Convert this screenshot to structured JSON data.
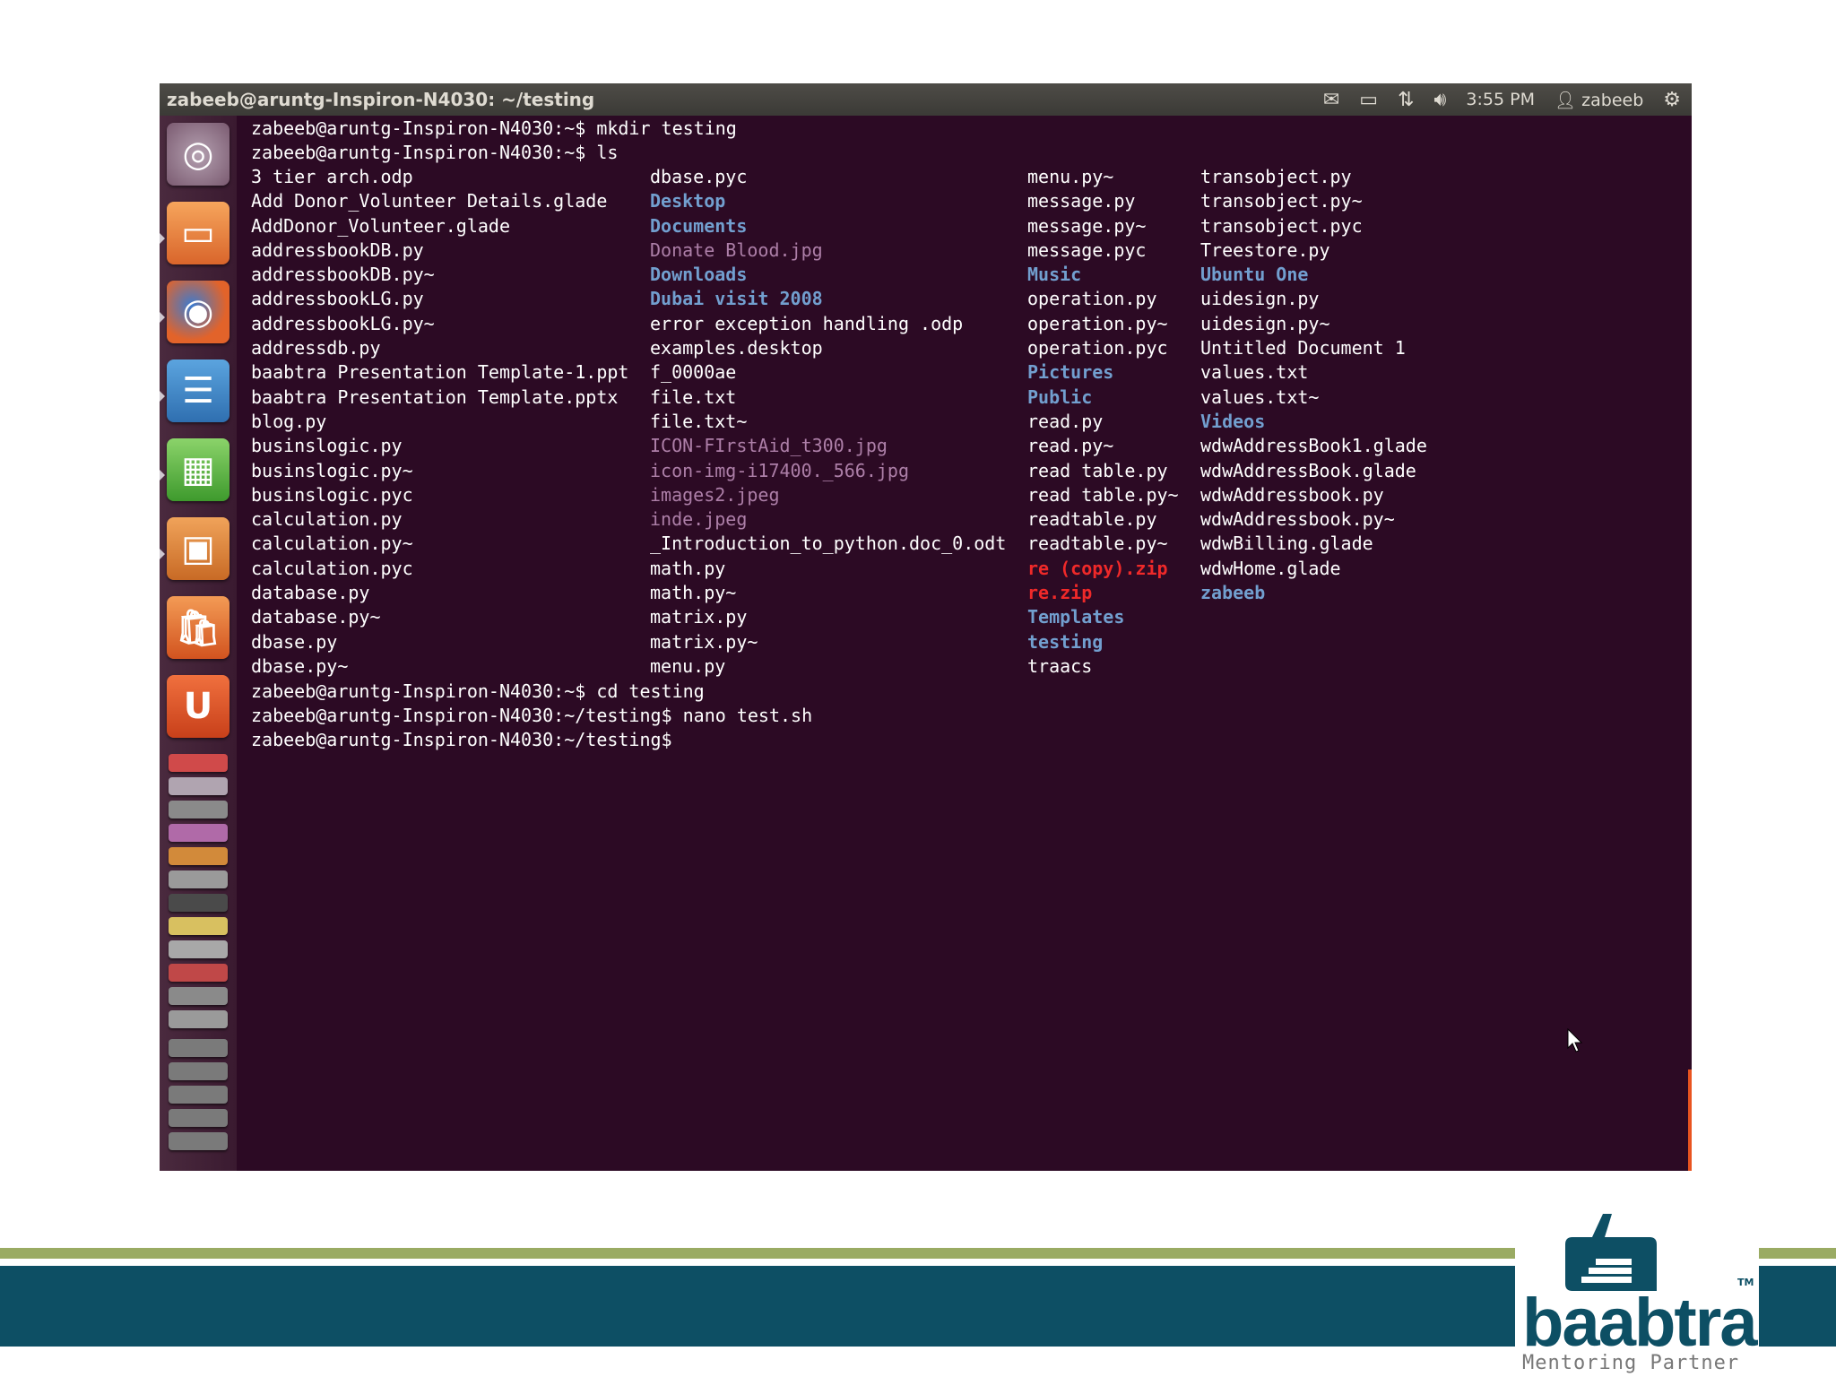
{
  "topbar": {
    "title": "zabeeb@aruntg-Inspiron-N4030: ~/testing",
    "clock": "3:55 PM",
    "user": "zabeeb",
    "icons": [
      "mail-icon",
      "battery-icon",
      "network-icon",
      "volume-icon",
      "user-icon",
      "power-icon"
    ]
  },
  "terminal": {
    "lines_top": [
      "zabeeb@aruntg-Inspiron-N4030:~$ mkdir testing",
      "zabeeb@aruntg-Inspiron-N4030:~$ ls"
    ],
    "col1": [
      {
        "t": "3 tier arch.odp",
        "k": "file"
      },
      {
        "t": "Add Donor_Volunteer Details.glade",
        "k": "file"
      },
      {
        "t": "AddDonor_Volunteer.glade",
        "k": "file"
      },
      {
        "t": "addressbookDB.py",
        "k": "file"
      },
      {
        "t": "addressbookDB.py~",
        "k": "file"
      },
      {
        "t": "addressbookLG.py",
        "k": "file"
      },
      {
        "t": "addressbookLG.py~",
        "k": "file"
      },
      {
        "t": "addressdb.py",
        "k": "file"
      },
      {
        "t": "baabtra Presentation Template-1.ppt",
        "k": "file"
      },
      {
        "t": "baabtra Presentation Template.pptx",
        "k": "file"
      },
      {
        "t": "blog.py",
        "k": "file"
      },
      {
        "t": "businslogic.py",
        "k": "file"
      },
      {
        "t": "businslogic.py~",
        "k": "file"
      },
      {
        "t": "businslogic.pyc",
        "k": "file"
      },
      {
        "t": "calculation.py",
        "k": "file"
      },
      {
        "t": "calculation.py~",
        "k": "file"
      },
      {
        "t": "calculation.pyc",
        "k": "file"
      },
      {
        "t": "database.py",
        "k": "file"
      },
      {
        "t": "database.py~",
        "k": "file"
      },
      {
        "t": "dbase.py",
        "k": "file"
      },
      {
        "t": "dbase.py~",
        "k": "file"
      }
    ],
    "col2": [
      {
        "t": "dbase.pyc",
        "k": "file"
      },
      {
        "t": "Desktop",
        "k": "dir"
      },
      {
        "t": "Documents",
        "k": "dir"
      },
      {
        "t": "Donate Blood.jpg",
        "k": "img"
      },
      {
        "t": "Downloads",
        "k": "dir"
      },
      {
        "t": "Dubai visit 2008",
        "k": "dir"
      },
      {
        "t": "error exception handling .odp",
        "k": "file"
      },
      {
        "t": "examples.desktop",
        "k": "file"
      },
      {
        "t": "f_0000ae",
        "k": "file"
      },
      {
        "t": "file.txt",
        "k": "file"
      },
      {
        "t": "file.txt~",
        "k": "file"
      },
      {
        "t": "ICON-FIrstAid_t300.jpg",
        "k": "img"
      },
      {
        "t": "icon-img-i17400._566.jpg",
        "k": "img"
      },
      {
        "t": "images2.jpeg",
        "k": "img"
      },
      {
        "t": "inde.jpeg",
        "k": "img"
      },
      {
        "t": "_Introduction_to_python.doc_0.odt",
        "k": "file"
      },
      {
        "t": "math.py",
        "k": "file"
      },
      {
        "t": "math.py~",
        "k": "file"
      },
      {
        "t": "matrix.py",
        "k": "file"
      },
      {
        "t": "matrix.py~",
        "k": "file"
      },
      {
        "t": "menu.py",
        "k": "file"
      }
    ],
    "col3": [
      {
        "t": "menu.py~",
        "k": "file"
      },
      {
        "t": "message.py",
        "k": "file"
      },
      {
        "t": "message.py~",
        "k": "file"
      },
      {
        "t": "message.pyc",
        "k": "file"
      },
      {
        "t": "Music",
        "k": "dir"
      },
      {
        "t": "operation.py",
        "k": "file"
      },
      {
        "t": "operation.py~",
        "k": "file"
      },
      {
        "t": "operation.pyc",
        "k": "file"
      },
      {
        "t": "Pictures",
        "k": "dir"
      },
      {
        "t": "Public",
        "k": "dir"
      },
      {
        "t": "read.py",
        "k": "file"
      },
      {
        "t": "read.py~",
        "k": "file"
      },
      {
        "t": "read table.py",
        "k": "file"
      },
      {
        "t": "read table.py~",
        "k": "file"
      },
      {
        "t": "readtable.py",
        "k": "file"
      },
      {
        "t": "readtable.py~",
        "k": "file"
      },
      {
        "t": "re (copy).zip",
        "k": "zip"
      },
      {
        "t": "re.zip",
        "k": "zip"
      },
      {
        "t": "Templates",
        "k": "dir"
      },
      {
        "t": "testing",
        "k": "dir"
      },
      {
        "t": "traacs",
        "k": "file"
      }
    ],
    "col4": [
      {
        "t": "transobject.py",
        "k": "file"
      },
      {
        "t": "transobject.py~",
        "k": "file"
      },
      {
        "t": "transobject.pyc",
        "k": "file"
      },
      {
        "t": "Treestore.py",
        "k": "file"
      },
      {
        "t": "Ubuntu One",
        "k": "dir"
      },
      {
        "t": "uidesign.py",
        "k": "file"
      },
      {
        "t": "uidesign.py~",
        "k": "file"
      },
      {
        "t": "Untitled Document 1",
        "k": "file"
      },
      {
        "t": "values.txt",
        "k": "file"
      },
      {
        "t": "values.txt~",
        "k": "file"
      },
      {
        "t": "Videos",
        "k": "dir"
      },
      {
        "t": "wdwAddressBook1.glade",
        "k": "file"
      },
      {
        "t": "wdwAddressBook.glade",
        "k": "file"
      },
      {
        "t": "wdwAddressbook.py",
        "k": "file"
      },
      {
        "t": "wdwAddressbook.py~",
        "k": "file"
      },
      {
        "t": "wdwBilling.glade",
        "k": "file"
      },
      {
        "t": "wdwHome.glade",
        "k": "file"
      },
      {
        "t": "zabeeb",
        "k": "dir"
      }
    ],
    "lines_bottom": [
      "zabeeb@aruntg-Inspiron-N4030:~$ cd testing",
      "zabeeb@aruntg-Inspiron-N4030:~/testing$ nano test.sh",
      "zabeeb@aruntg-Inspiron-N4030:~/testing$"
    ]
  },
  "colors": {
    "terminal_bg": "#2c0a24",
    "dir": "#729fcf",
    "img": "#ad7fa8",
    "zip": "#ef2929",
    "brand_teal": "#0d4f64",
    "brand_green": "#9aab63"
  },
  "branding": {
    "logo_text": "baabtra",
    "tagline": "Mentoring Partner",
    "tm": "TM"
  }
}
